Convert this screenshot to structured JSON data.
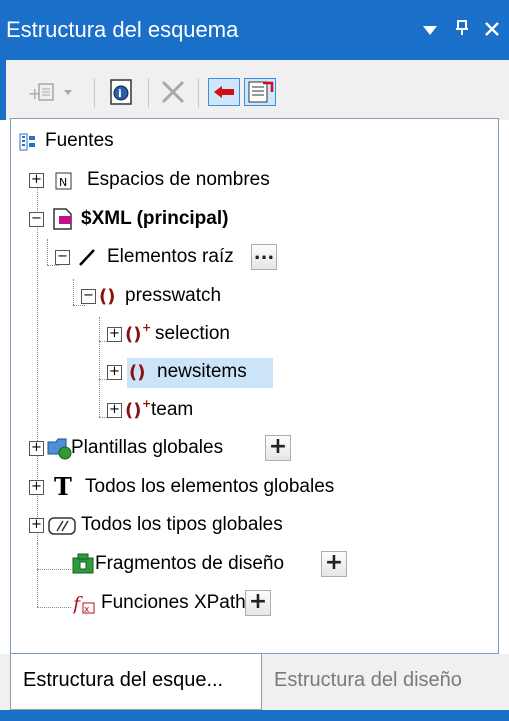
{
  "window": {
    "title": "Estructura del esquema",
    "controls": [
      "▼",
      "⊥",
      "✕"
    ]
  },
  "toolbar": {
    "add_label": "+",
    "buttons": [
      "add-element-dropdown",
      "schema-info",
      "delete",
      "collapse",
      "expand-all"
    ]
  },
  "tree": {
    "root": "Fuentes",
    "namespaces": "Espacios de nombres",
    "xml_main": "$XML (principal)",
    "root_elements": "Elementos raíz",
    "more": "...",
    "presswatch": "presswatch",
    "selection": "selection",
    "newsitems": "newsitems",
    "team": "team",
    "global_templates": "Plantillas globales",
    "all_global_elements": "Todos los elementos globales",
    "all_global_types": "Todos los tipos globales",
    "design_fragments": "Fragmentos de diseño",
    "xpath_functions": "Funciones XPath",
    "plus": "+"
  },
  "tabs": {
    "active": "Estructura del esque...",
    "inactive": "Estructura del diseño"
  },
  "colors": {
    "accent": "#1a6fc8",
    "selected": "#cce4f7",
    "element_icon": "#8b1010"
  }
}
